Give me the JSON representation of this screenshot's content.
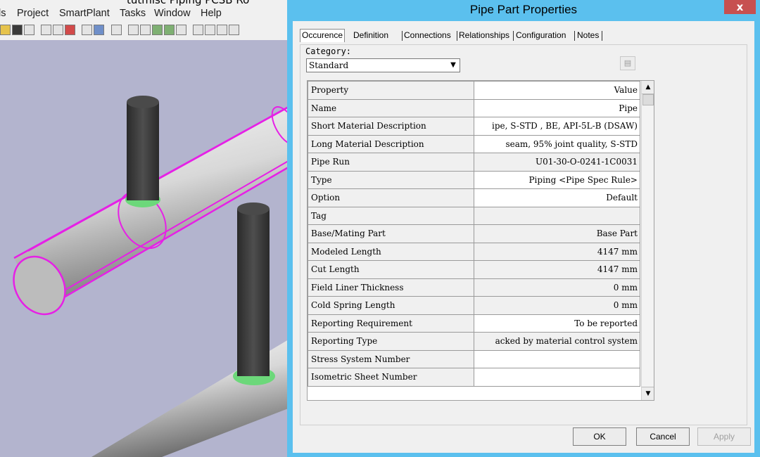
{
  "app": {
    "title": "tutmisc Piping PCSB Ro",
    "menu": [
      "ls",
      "Project",
      "SmartPlant",
      "Tasks",
      "Window",
      "Help"
    ]
  },
  "dialog": {
    "title": "Pipe Part Properties",
    "close_symbol": "x",
    "tabs": [
      "Occurence",
      "Definition",
      "Connections",
      "Relationships",
      "Configuration",
      "Notes"
    ],
    "active_tab": "Occurence",
    "category_label": "Category:",
    "category_value": "Standard",
    "grid_header": {
      "property": "Property",
      "value": "Value"
    },
    "rows": [
      {
        "property": "Name",
        "value": "Pipe"
      },
      {
        "property": "Short Material Description",
        "value": "ipe, S-STD , BE, API-5L-B (DSAW)"
      },
      {
        "property": "Long Material Description",
        "value": "seam, 95% joint quality, S-STD"
      },
      {
        "property": "Pipe Run",
        "value": "U01-30-O-0241-1C0031"
      },
      {
        "property": "Type",
        "value": "Piping <Pipe Spec Rule>"
      },
      {
        "property": "Option",
        "value": "Default"
      },
      {
        "property": "Tag",
        "value": ""
      },
      {
        "property": "Base/Mating Part",
        "value": "Base Part"
      },
      {
        "property": "Modeled Length",
        "value": "4147 mm"
      },
      {
        "property": "Cut Length",
        "value": "4147 mm"
      },
      {
        "property": "Field Liner Thickness",
        "value": "0 mm"
      },
      {
        "property": "Cold Spring Length",
        "value": "0 mm"
      },
      {
        "property": "Reporting Requirement",
        "value": "To be reported"
      },
      {
        "property": "Reporting Type",
        "value": "acked by material control system"
      },
      {
        "property": "Stress System Number",
        "value": ""
      },
      {
        "property": "Isometric Sheet Number",
        "value": ""
      }
    ],
    "buttons": {
      "ok": "OK",
      "cancel": "Cancel",
      "apply": "Apply"
    }
  },
  "colors": {
    "dialog_frame": "#5bc0ee",
    "close_button": "#c75050",
    "viewport_bg": "#b3b4ce",
    "highlight": "#e620e6",
    "weld_marker": "#6cd87a"
  }
}
